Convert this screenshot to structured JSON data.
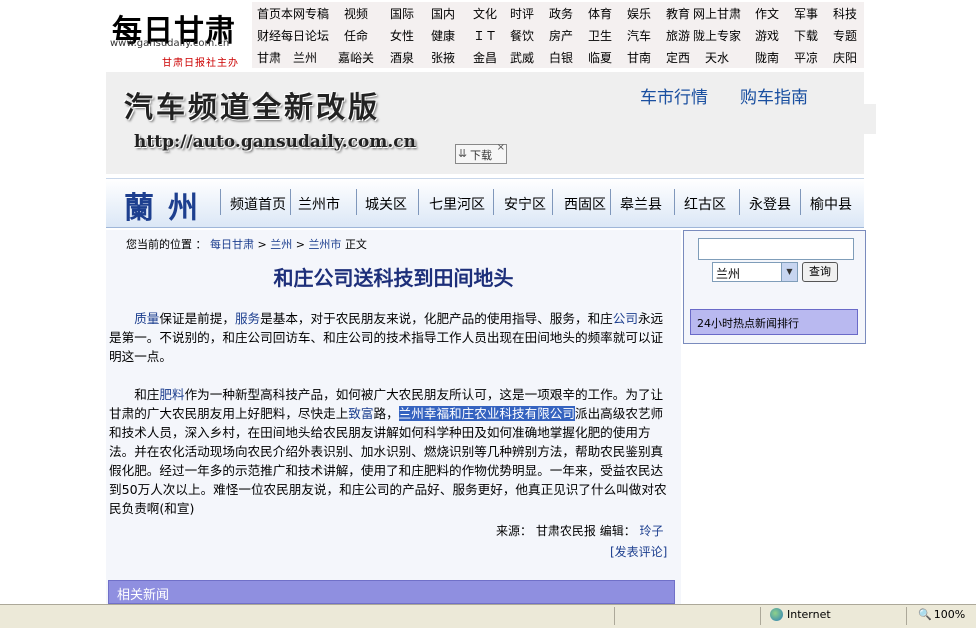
{
  "header": {
    "logo_text": "每日甘肃",
    "logo_url": "www.gansudaily.com.cn",
    "logo_sub": "甘肃日报社主办",
    "nav_rows": [
      [
        "首页",
        "本网专稿",
        "视频",
        "国际",
        "国内",
        "文化",
        "时评",
        "政务",
        "体育",
        "娱乐",
        "教育",
        "网上甘肃",
        "作文",
        "军事",
        "科技"
      ],
      [
        "财经",
        "每日论坛",
        "任命",
        "女性",
        "健康",
        "ＩＴ",
        "餐饮",
        "房产",
        "卫生",
        "汽车",
        "旅游",
        "陇上专家",
        "游戏",
        "下载",
        "专题"
      ],
      [
        "甘肃",
        "兰州",
        "嘉峪关",
        "酒泉",
        "张掖",
        "金昌",
        "武威",
        "白银",
        "临夏",
        "甘南",
        "定西",
        "天水",
        "陇南",
        "平凉",
        "庆阳"
      ]
    ]
  },
  "banner": {
    "title": "汽车频道全新改版",
    "url": "http://auto.gansudaily.com.cn",
    "link1": "车市行情",
    "link2": "购车指南",
    "download_label": "下载",
    "download_close": "×"
  },
  "citynav": {
    "logo": "蘭州",
    "items": [
      "频道首页",
      "兰州市",
      "城关区",
      "七里河区",
      "安宁区",
      "西固区",
      "皋兰县",
      "红古区",
      "永登县",
      "榆中县"
    ]
  },
  "breadcrumb": {
    "prefix": "您当前的位置 ：",
    "links": [
      "每日甘肃",
      "兰州",
      "兰州市"
    ],
    "sep": ">",
    "current": "正文"
  },
  "article": {
    "title": "和庄公司送科技到田间地头",
    "p1": {
      "indent": "　　",
      "link_quality": "质量",
      "t1": "保证是前提，",
      "link_service": "服务",
      "t2": "是基本，对于农民朋友来说，化肥产品的使用指导、服务，和庄",
      "link_company": "公司",
      "t3": "永远是第一。不说别的，和庄公司回访车、和庄公司的技术指导工作人员出现在田间地头的频率就可以证明这一点。"
    },
    "p2": {
      "indent": "　　",
      "t1": "和庄",
      "link_fertilizer": "肥料",
      "t2": "作为一种新型高科技产品，如何被广大农民朋友所认可，这是一项艰辛的工作。为了让甘肃的广大农民朋友用上好肥料，尽快走上",
      "link_rich": "致富",
      "t3": "路，",
      "highlight": "兰州幸福和庄农业科技有限公司",
      "t4": "派出高级农艺师和技术人员，深入乡村，在田间地头给农民朋友讲解如何科学种田及如何准确地掌握化肥的使用方法。并在农化活动现场向农民介绍外表识别、加水识别、燃烧识别等几种辨别方法，帮助农民鉴别真假化肥。经过一年多的示范推广和技术讲解，使用了和庄肥料的作物优势明显。一年来，受益农民达到50万人次以上。难怪一位农民朋友说，和庄公司的产品好、服务更好，他真正见识了什么叫做对农民负责啊(和宣)"
    },
    "source_label": "来源：",
    "source": "甘肃农民报",
    "editor_label": "编辑：",
    "editor": "玲子",
    "comment": "[发表评论]",
    "related": "相关新闻"
  },
  "sidebar": {
    "search_value": "",
    "select_value": "兰州",
    "query_button": "查询",
    "rank_title": "24小时热点新闻排行"
  },
  "statusbar": {
    "zone": "Internet",
    "zoom": "100%"
  }
}
